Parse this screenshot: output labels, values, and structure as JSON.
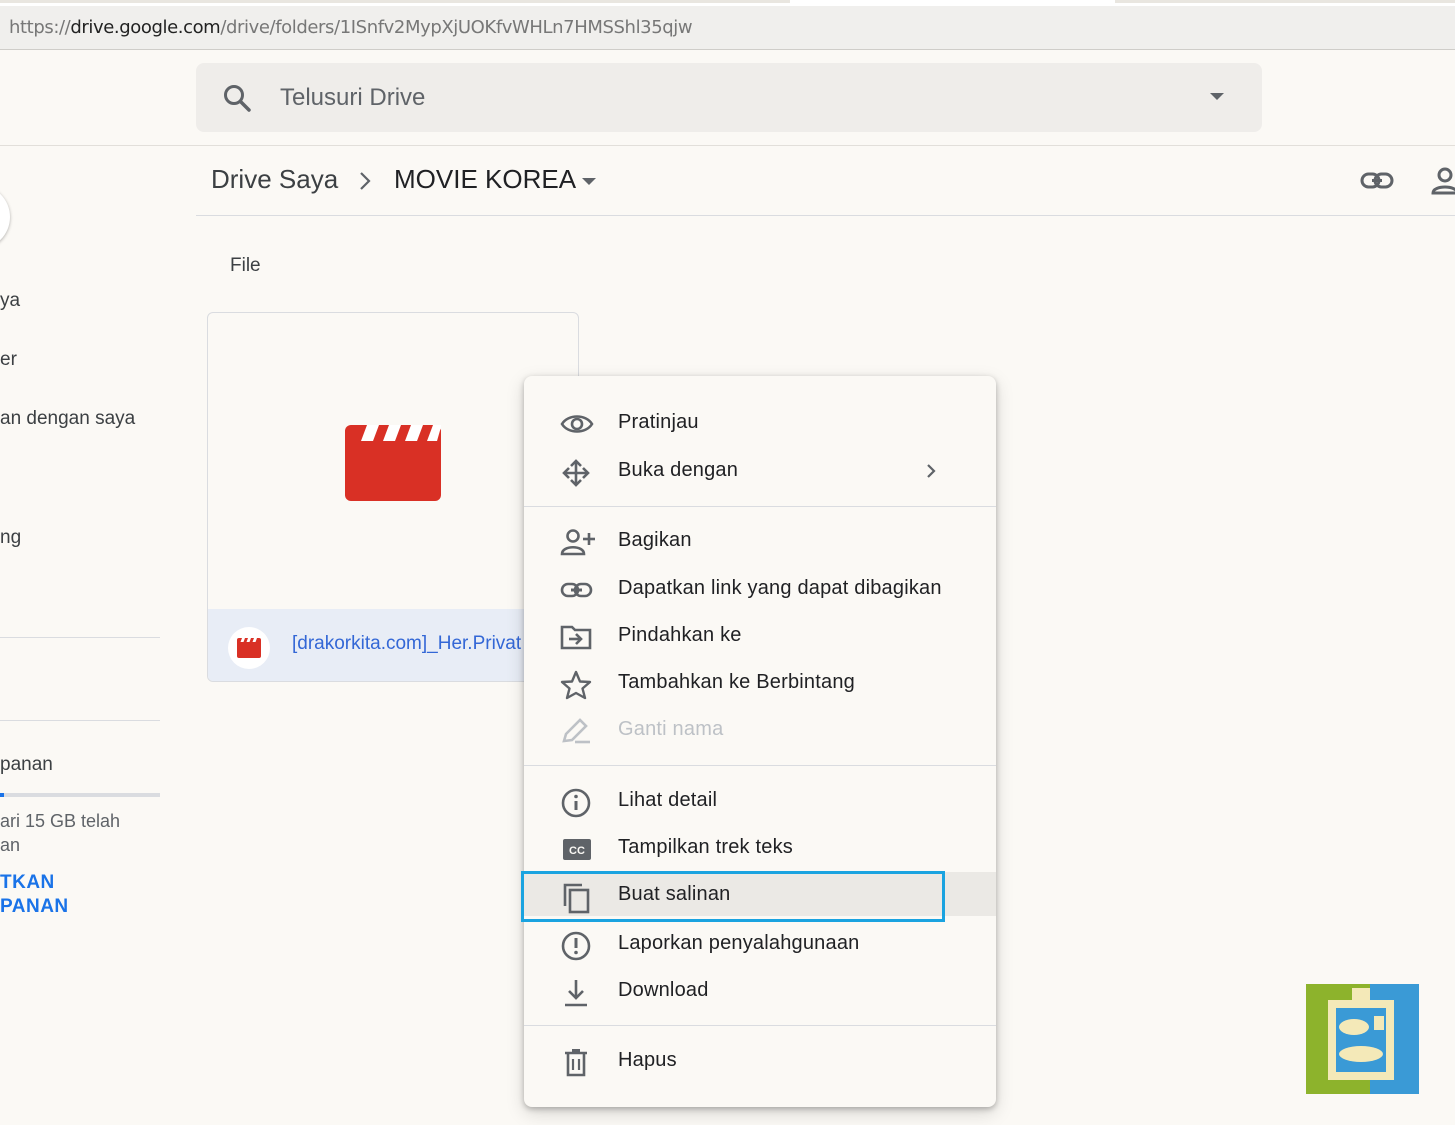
{
  "browser": {
    "url_scheme": "https://",
    "url_host": "drive.google.com",
    "url_path": "/drive/folders/1ISnfv2MypXjUOKfvWHLn7HMSShl35qjw"
  },
  "search": {
    "placeholder": "Telusuri Drive"
  },
  "breadcrumb": {
    "root": "Drive Saya",
    "current": "MOVIE KOREA"
  },
  "sidebar": {
    "items": [
      "ya",
      "er",
      "an dengan saya",
      "ng"
    ],
    "storage_label": "panan",
    "storage_text_1": "ari 15 GB telah",
    "storage_text_2": "an",
    "upgrade_1": "TKAN",
    "upgrade_2": "PANAN"
  },
  "main": {
    "section_label": "File",
    "file": {
      "name": "[drakorkita.com]_Her.Privat",
      "icon": "video-clapper-icon",
      "icon_color": "#d93025"
    }
  },
  "context_menu": {
    "items": [
      {
        "label": "Pratinjau",
        "icon": "eye-icon"
      },
      {
        "label": "Buka dengan",
        "icon": "move-arrows-icon",
        "chevron": "›"
      },
      {
        "label": "Bagikan",
        "icon": "person-add-icon"
      },
      {
        "label": "Dapatkan link yang dapat dibagikan",
        "icon": "link-icon"
      },
      {
        "label": "Pindahkan ke",
        "icon": "folder-move-icon"
      },
      {
        "label": "Tambahkan ke Berbintang",
        "icon": "star-icon"
      },
      {
        "label": "Ganti nama",
        "icon": "pencil-icon",
        "disabled": true
      },
      {
        "label": "Lihat detail",
        "icon": "info-icon"
      },
      {
        "label": "Tampilkan trek teks",
        "icon": "closed-caption-icon"
      },
      {
        "label": "Buat salinan",
        "icon": "copy-icon",
        "highlighted": true
      },
      {
        "label": "Laporkan penyalahgunaan",
        "icon": "report-icon"
      },
      {
        "label": "Download",
        "icon": "download-icon"
      },
      {
        "label": "Hapus",
        "icon": "trash-icon"
      }
    ]
  },
  "colors": {
    "highlight_border": "#1aa3e0",
    "link_blue": "#1a73e8",
    "file_red": "#d93025"
  }
}
